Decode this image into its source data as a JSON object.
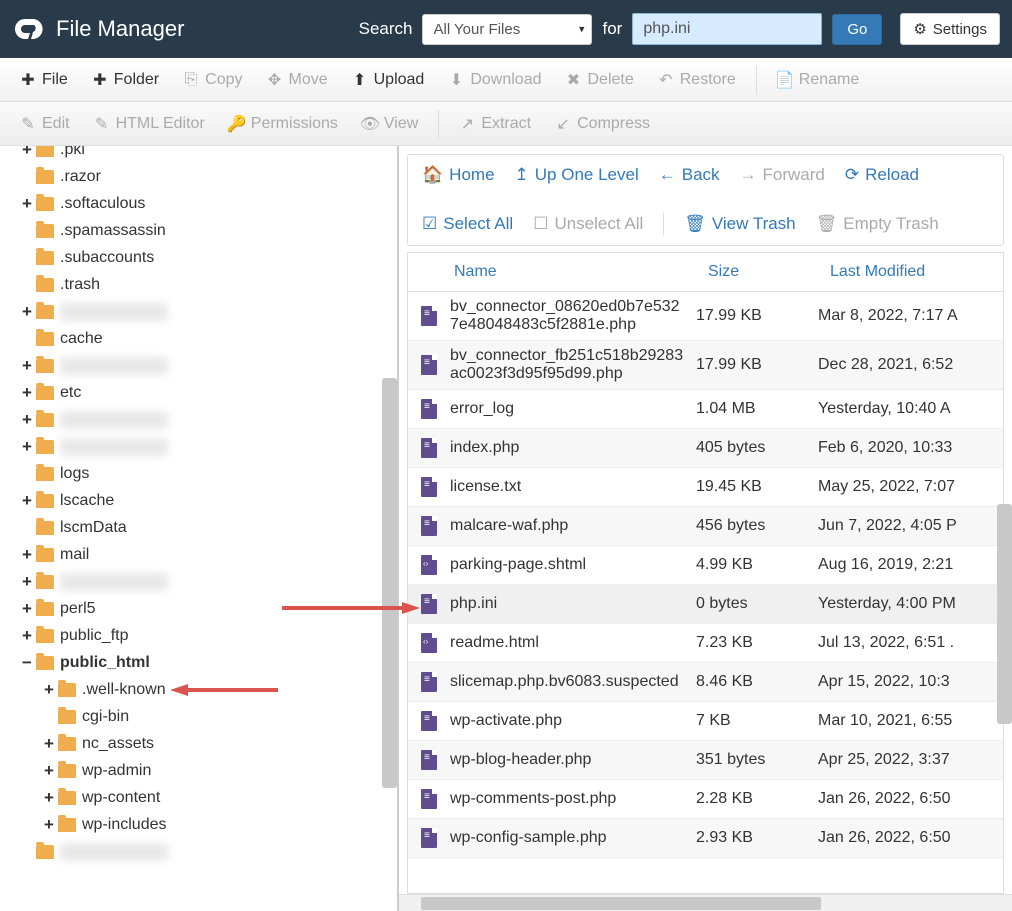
{
  "header": {
    "title": "File Manager",
    "search_label": "Search",
    "search_scope": "All Your Files",
    "for_label": "for",
    "search_value": "php.ini",
    "go_label": "Go",
    "settings_label": "Settings"
  },
  "toolbar1": [
    {
      "icon": "plus",
      "label": "File",
      "disabled": false
    },
    {
      "icon": "plus",
      "label": "Folder",
      "disabled": false
    },
    {
      "icon": "copy",
      "label": "Copy",
      "disabled": true
    },
    {
      "icon": "move",
      "label": "Move",
      "disabled": true
    },
    {
      "icon": "upload",
      "label": "Upload",
      "disabled": false
    },
    {
      "icon": "download",
      "label": "Download",
      "disabled": true
    },
    {
      "icon": "delete",
      "label": "Delete",
      "disabled": true
    },
    {
      "icon": "restore",
      "label": "Restore",
      "disabled": true
    },
    {
      "sep": true
    },
    {
      "icon": "rename",
      "label": "Rename",
      "disabled": true
    }
  ],
  "toolbar2": [
    {
      "icon": "edit",
      "label": "Edit",
      "disabled": true
    },
    {
      "icon": "html",
      "label": "HTML Editor",
      "disabled": true
    },
    {
      "icon": "perm",
      "label": "Permissions",
      "disabled": true
    },
    {
      "icon": "view",
      "label": "View",
      "disabled": true
    },
    {
      "sep": true
    },
    {
      "icon": "extract",
      "label": "Extract",
      "disabled": true
    },
    {
      "icon": "compress",
      "label": "Compress",
      "disabled": true
    }
  ],
  "nav": {
    "home": "Home",
    "up": "Up One Level",
    "back": "Back",
    "forward": "Forward",
    "reload": "Reload",
    "select_all": "Select All",
    "unselect_all": "Unselect All",
    "view_trash": "View Trash",
    "empty_trash": "Empty Trash"
  },
  "columns": {
    "name": "Name",
    "size": "Size",
    "modified": "Last Modified"
  },
  "tree": [
    {
      "indent": 1,
      "toggle": "+",
      "label": ".pki",
      "cut": true
    },
    {
      "indent": 1,
      "toggle": "",
      "label": ".razor"
    },
    {
      "indent": 1,
      "toggle": "+",
      "label": ".softaculous"
    },
    {
      "indent": 1,
      "toggle": "",
      "label": ".spamassassin"
    },
    {
      "indent": 1,
      "toggle": "",
      "label": ".subaccounts"
    },
    {
      "indent": 1,
      "toggle": "",
      "label": ".trash"
    },
    {
      "indent": 1,
      "toggle": "+",
      "label": "",
      "blurred": true
    },
    {
      "indent": 1,
      "toggle": "",
      "label": "cache"
    },
    {
      "indent": 1,
      "toggle": "+",
      "label": "",
      "blurred": true
    },
    {
      "indent": 1,
      "toggle": "+",
      "label": "etc"
    },
    {
      "indent": 1,
      "toggle": "+",
      "label": "",
      "blurred": true
    },
    {
      "indent": 1,
      "toggle": "+",
      "label": "",
      "blurred": true
    },
    {
      "indent": 1,
      "toggle": "",
      "label": "logs"
    },
    {
      "indent": 1,
      "toggle": "+",
      "label": "lscache"
    },
    {
      "indent": 1,
      "toggle": "",
      "label": "lscmData"
    },
    {
      "indent": 1,
      "toggle": "+",
      "label": "mail"
    },
    {
      "indent": 1,
      "toggle": "+",
      "label": "",
      "blurred": true
    },
    {
      "indent": 1,
      "toggle": "+",
      "label": "perl5"
    },
    {
      "indent": 1,
      "toggle": "+",
      "label": "public_ftp"
    },
    {
      "indent": 1,
      "toggle": "−",
      "label": "public_html",
      "bold": true,
      "open": true
    },
    {
      "indent": 2,
      "toggle": "+",
      "label": ".well-known"
    },
    {
      "indent": 2,
      "toggle": "",
      "label": "cgi-bin"
    },
    {
      "indent": 2,
      "toggle": "+",
      "label": "nc_assets"
    },
    {
      "indent": 2,
      "toggle": "+",
      "label": "wp-admin"
    },
    {
      "indent": 2,
      "toggle": "+",
      "label": "wp-content"
    },
    {
      "indent": 2,
      "toggle": "+",
      "label": "wp-includes"
    },
    {
      "indent": 1,
      "toggle": "",
      "label": "",
      "blurred": true
    }
  ],
  "files": [
    {
      "name": "bv_connector_08620ed0b7e5327e48048483c5f2881e.php",
      "size": "17.99 KB",
      "mod": "Mar 8, 2022, 7:17 A",
      "icon": "doc"
    },
    {
      "name": "bv_connector_fb251c518b29283ac0023f3d95f95d99.php",
      "size": "17.99 KB",
      "mod": "Dec 28, 2021, 6:52",
      "icon": "doc"
    },
    {
      "name": "error_log",
      "size": "1.04 MB",
      "mod": "Yesterday, 10:40 A",
      "icon": "doc"
    },
    {
      "name": "index.php",
      "size": "405 bytes",
      "mod": "Feb 6, 2020, 10:33",
      "icon": "doc"
    },
    {
      "name": "license.txt",
      "size": "19.45 KB",
      "mod": "May 25, 2022, 7:07",
      "icon": "doc"
    },
    {
      "name": "malcare-waf.php",
      "size": "456 bytes",
      "mod": "Jun 7, 2022, 4:05 P",
      "icon": "doc"
    },
    {
      "name": "parking-page.shtml",
      "size": "4.99 KB",
      "mod": "Aug 16, 2019, 2:21",
      "icon": "code"
    },
    {
      "name": "php.ini",
      "size": "0 bytes",
      "mod": "Yesterday, 4:00 PM",
      "icon": "doc",
      "hl": true
    },
    {
      "name": "readme.html",
      "size": "7.23 KB",
      "mod": "Jul 13, 2022, 6:51 .",
      "icon": "code"
    },
    {
      "name": "slicemap.php.bv6083.suspected",
      "size": "8.46 KB",
      "mod": "Apr 15, 2022, 10:3",
      "icon": "doc"
    },
    {
      "name": "wp-activate.php",
      "size": "7 KB",
      "mod": "Mar 10, 2021, 6:55",
      "icon": "doc"
    },
    {
      "name": "wp-blog-header.php",
      "size": "351 bytes",
      "mod": "Apr 25, 2022, 3:37",
      "icon": "doc"
    },
    {
      "name": "wp-comments-post.php",
      "size": "2.28 KB",
      "mod": "Jan 26, 2022, 6:50",
      "icon": "doc"
    },
    {
      "name": "wp-config-sample.php",
      "size": "2.93 KB",
      "mod": "Jan 26, 2022, 6:50",
      "icon": "doc"
    }
  ]
}
